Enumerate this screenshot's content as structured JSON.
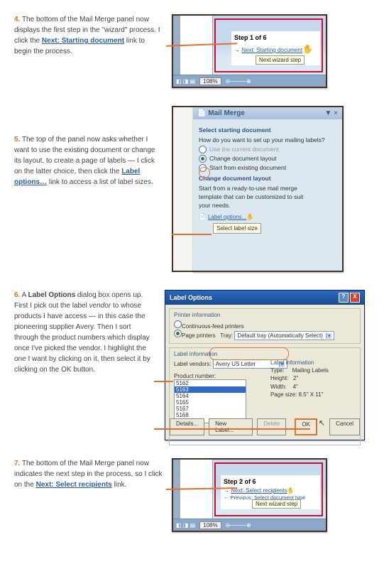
{
  "steps": {
    "s4": {
      "num": "4.",
      "text_a": "The bottom of the Mail Merge panel now displays the first step in the \"wizard\" process.  I click the ",
      "link": "Next: Starting document",
      "text_b": " link to begin the process."
    },
    "s5": {
      "num": "5.",
      "text_a": "The top of the panel now asks whether I want to use the existing document or change its layout, to create a page of labels — I click on the latter choice, then click the ",
      "link": "Label options…",
      "text_b": " link to access a list of label sizes."
    },
    "s6": {
      "num": "6.",
      "text_a": "A ",
      "bold1": "Label Options",
      "text_b": " dialog box opens up.  First I pick out the label ",
      "ital": "vendor",
      "text_c": " to whose products I have access — in this case the pioneering supplier Avery.  Then I sort through the product numbers which display once I've picked the vendor.  I highlight the one I want by clicking on it, then select it by clicking on the OK button."
    },
    "s7": {
      "num": "7.",
      "text_a": "The bottom of the Mail Merge panel now indicates the next step in the process, so I click on the ",
      "link": "Next: Select recipients",
      "text_b": " link."
    }
  },
  "ss1": {
    "step": "Step 1 of 6",
    "next": "Next: Starting document",
    "tooltip": "Next wizard step",
    "zoom": "108%"
  },
  "ss2": {
    "title": "Mail Merge",
    "sect1": "Select starting document",
    "q": "How do you want to set up your mailing labels?",
    "opt1": "Use the current document",
    "opt2": "Change document layout",
    "opt3": "Start from existing document",
    "sect2": "Change document layout",
    "desc": "Start from a ready-to-use mail merge template that can be customized to suit your needs.",
    "link": "Label options...",
    "tooltip": "Select label size"
  },
  "ss3": {
    "title": "Label Options",
    "pi": "Printer information",
    "opt_cf": "Continuous-feed printers",
    "opt_pp": "Page printers",
    "tray_lbl": "Tray:",
    "tray": "Default tray (Automatically Select)",
    "li": "Label information",
    "vendor_lbl": "Label vendors:",
    "vendor": "Avery US Letter",
    "pn_lbl": "Product number:",
    "products": [
      "5162",
      "5163",
      "5164",
      "5165",
      "5167",
      "5168"
    ],
    "info_lbl": "Label information",
    "type_lbl": "Type:",
    "type": "Mailing Labels",
    "h_lbl": "Height:",
    "h": "2\"",
    "w_lbl": "Width:",
    "w": "4\"",
    "ps_lbl": "Page size:",
    "ps": "8.5\" X 11\"",
    "btn_d": "Details...",
    "btn_n": "New Label...",
    "btn_del": "Delete",
    "btn_ok": "OK",
    "btn_c": "Cancel"
  },
  "ss4": {
    "step": "Step 2 of 6",
    "next": "Next: Select recipients",
    "prev": "Previous: Select document type",
    "tooltip": "Next wizard step",
    "zoom": "108%"
  }
}
